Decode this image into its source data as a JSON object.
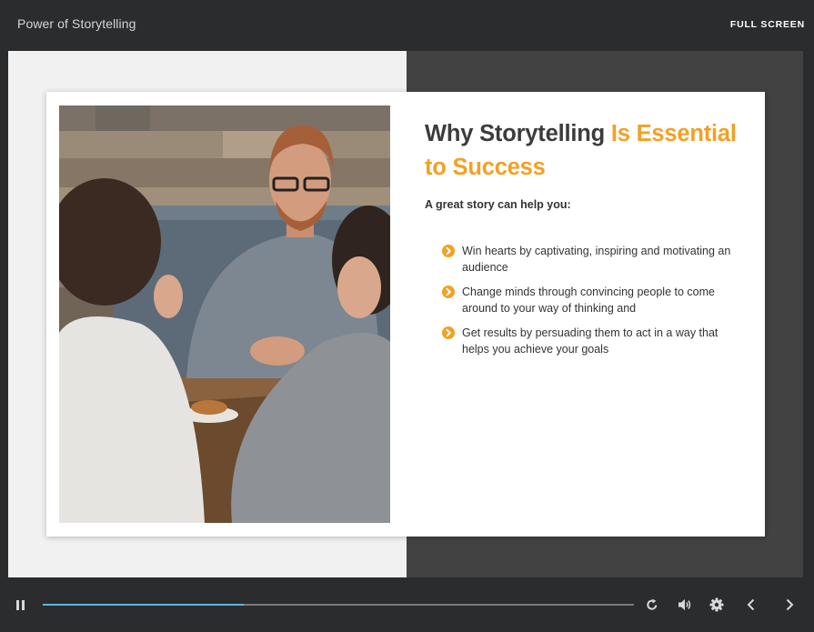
{
  "header": {
    "course_title": "Power of Storytelling",
    "fullscreen_label": "FULL SCREEN"
  },
  "slide": {
    "headline_plain": "Why Storytelling ",
    "headline_accent": "Is Essential to Success",
    "subheading": "A great story can help you:",
    "bullets": [
      {
        "text": "Win hearts by captivating, inspiring and motivating an audience"
      },
      {
        "text": "Change minds through convincing people to come around to your way of thinking and"
      },
      {
        "text": "Get results by persuading them to act in a way that helps you achieve your goals"
      }
    ],
    "image_icon": "photo-three-people-at-table"
  },
  "player": {
    "progress": 0.34,
    "icons": {
      "pause": "pause-icon",
      "replay": "replay-icon",
      "volume": "volume-icon",
      "settings": "gear-icon",
      "prev": "chevron-left-icon",
      "next": "chevron-right-icon"
    }
  },
  "colors": {
    "accent": "#f2a125",
    "progress": "#5ab4e8",
    "chrome": "#2b2c2e"
  }
}
